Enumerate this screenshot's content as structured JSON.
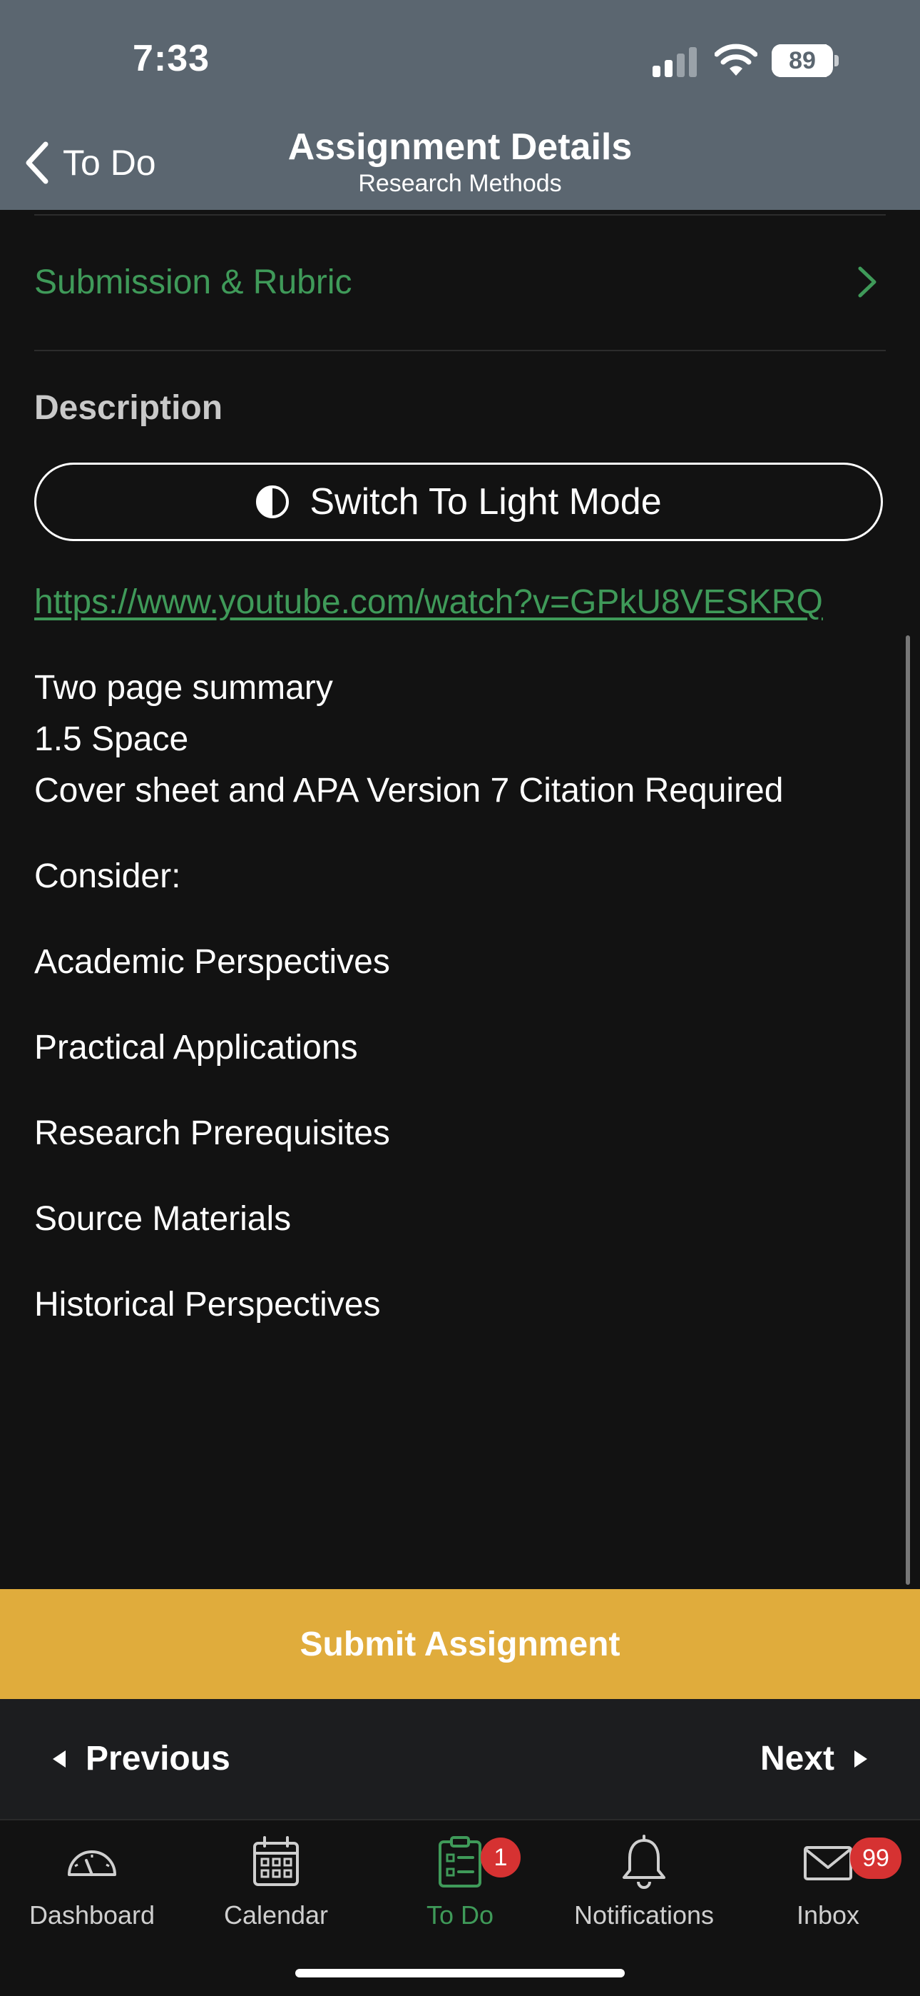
{
  "status_bar": {
    "time": "7:33",
    "battery_percent": 89
  },
  "nav": {
    "back_label": "To Do",
    "title": "Assignment Details",
    "subtitle": "Research Methods"
  },
  "submission_row": {
    "label": "Submission & Rubric"
  },
  "description": {
    "heading": "Description",
    "light_mode_button": "Switch To Light Mode",
    "link": "https://www.youtube.com/watch?v=GPkU8VESKRQ",
    "lines": [
      "Two page summary",
      "1.5 Space",
      "Cover sheet and APA Version 7 Citation Required",
      "Consider:",
      "Academic Perspectives",
      "Practical Applications",
      "Research Prerequisites",
      "Source Materials",
      "Historical Perspectives"
    ]
  },
  "submit_button": "Submit Assignment",
  "pager": {
    "previous": "Previous",
    "next": "Next"
  },
  "tabbar": {
    "tabs": [
      {
        "label": "Dashboard",
        "icon": "dashboard-gauge-icon",
        "active": false
      },
      {
        "label": "Calendar",
        "icon": "calendar-icon",
        "active": false
      },
      {
        "label": "To Do",
        "icon": "clipboard-icon",
        "active": true,
        "badge": "1"
      },
      {
        "label": "Notifications",
        "icon": "bell-icon",
        "active": false
      },
      {
        "label": "Inbox",
        "icon": "envelope-icon",
        "active": false,
        "badge": "99"
      }
    ]
  },
  "colors": {
    "header_bg": "#5b6670",
    "accent_green": "#3f9a59",
    "submit_bg": "#e0ac3c",
    "badge_red": "#d63232",
    "page_bg": "#121212"
  }
}
